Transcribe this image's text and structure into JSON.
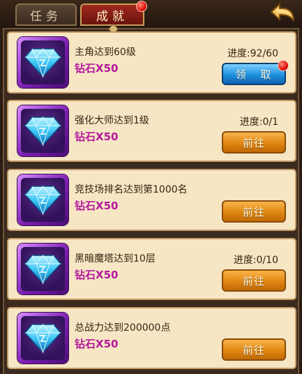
{
  "tabs": {
    "task_label": "任务",
    "achievement_label": "成就"
  },
  "icons": {
    "back": "back-arrow-icon",
    "reward": "diamond-icon"
  },
  "colors": {
    "reward_text": "#b4189c",
    "claim_button": "#1e90e0",
    "go_button": "#e08612"
  },
  "tasks": [
    {
      "title": "主角达到60级",
      "reward": "钻石X50",
      "progress": "进度:92/60",
      "button": "领 取",
      "button_type": "claim",
      "notification": true
    },
    {
      "title": "强化大师达到1级",
      "reward": "钻石X50",
      "progress": "进度:0/1",
      "button": "前往",
      "button_type": "go",
      "notification": false
    },
    {
      "title": "竞技场排名达到第1000名",
      "reward": "钻石X50",
      "progress": "",
      "button": "前往",
      "button_type": "go",
      "notification": false
    },
    {
      "title": "黑暗魔塔达到10层",
      "reward": "钻石X50",
      "progress": "进度:0/10",
      "button": "前往",
      "button_type": "go",
      "notification": false
    },
    {
      "title": "总战力达到200000点",
      "reward": "钻石X50",
      "progress": "",
      "button": "前往",
      "button_type": "go",
      "notification": false
    }
  ]
}
